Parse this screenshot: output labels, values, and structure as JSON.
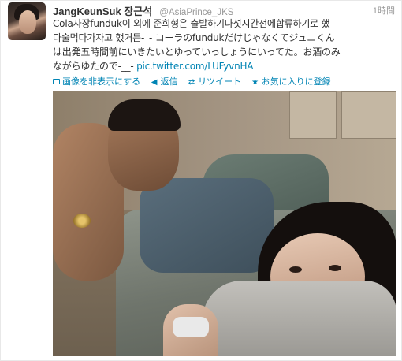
{
  "tweet": {
    "fullname": "JangKeunSuk 장근석",
    "handle": "@AsiaPrince_JKS",
    "time": "1時間",
    "text_lines": [
      "Cola사장funduk이 외에 준희형은 출발하기다섯시간전에합류하기로 했",
      "다술먹다가자고 했거든-_- コーラのfundukだけじゃなくてジュニくん",
      "は出発五時間前にいきたいとゆっていっしょうにいってた。お酒のみ",
      "ながらゆたので-__- "
    ],
    "link": "pic.twitter.com/LUFyvnHA"
  },
  "actions": {
    "hide_media": "画像を非表示にする",
    "reply": "返信",
    "retweet": "リツイート",
    "favorite": "お気に入りに登録"
  },
  "icons": {
    "hide_media": "image-icon",
    "reply": "reply-arrow-icon",
    "retweet": "retweet-icon",
    "favorite": "star-icon"
  },
  "colors": {
    "link": "#0084b4",
    "text": "#333333",
    "muted": "#999999"
  }
}
